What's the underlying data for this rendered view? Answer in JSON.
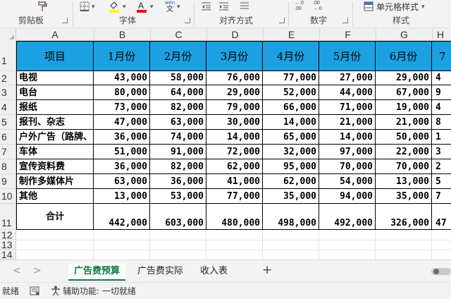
{
  "ribbon": {
    "clipboard": {
      "label": "剪贴板"
    },
    "font": {
      "label": "字体"
    },
    "alignment": {
      "label": "对齐方式"
    },
    "number": {
      "label": "数字"
    },
    "styles": {
      "label": "样式",
      "cell_styles_label": "单元格样式"
    },
    "wen_icon_text": "wén",
    "wen_icon_char": "文",
    "accent_colors": {
      "highlight": "#ffff00",
      "font_color": "#ff0000"
    }
  },
  "columns": [
    "A",
    "B",
    "C",
    "D",
    "E",
    "F",
    "G",
    "H"
  ],
  "rows": [
    "1",
    "2",
    "3",
    "4",
    "5",
    "6",
    "7",
    "8",
    "9",
    "10",
    "11",
    "12",
    "13",
    "14"
  ],
  "sheet": {
    "headers": [
      "项目",
      "1月份",
      "2月份",
      "3月份",
      "4月份",
      "5月份",
      "6月份",
      "7"
    ],
    "header_color": "#1ba1e2",
    "data": [
      {
        "item": "电视",
        "values": [
          "43,000",
          "58,000",
          "76,000",
          "77,000",
          "27,000",
          "29,000",
          "4"
        ]
      },
      {
        "item": "电台",
        "values": [
          "80,000",
          "64,000",
          "29,000",
          "52,000",
          "44,000",
          "67,000",
          "9"
        ]
      },
      {
        "item": "报纸",
        "values": [
          "73,000",
          "82,000",
          "79,000",
          "66,000",
          "71,000",
          "19,000",
          "4"
        ]
      },
      {
        "item": "报刊、杂志",
        "values": [
          "47,000",
          "63,000",
          "30,000",
          "14,000",
          "21,000",
          "21,000",
          "8"
        ]
      },
      {
        "item": "户外广告（路牌、",
        "values": [
          "36,000",
          "74,000",
          "14,000",
          "65,000",
          "14,000",
          "50,000",
          "1"
        ]
      },
      {
        "item": "车体",
        "values": [
          "51,000",
          "91,000",
          "72,000",
          "32,000",
          "97,000",
          "22,000",
          "3"
        ]
      },
      {
        "item": "宣传资料费",
        "values": [
          "36,000",
          "82,000",
          "62,000",
          "95,000",
          "70,000",
          "70,000",
          "2"
        ]
      },
      {
        "item": "制作多媒体片",
        "values": [
          "63,000",
          "36,000",
          "41,000",
          "62,000",
          "54,000",
          "13,000",
          "5"
        ]
      },
      {
        "item": "其他",
        "values": [
          "13,000",
          "53,000",
          "77,000",
          "35,000",
          "94,000",
          "35,000",
          "7"
        ]
      }
    ],
    "total": {
      "item": "合计",
      "values": [
        "442,000",
        "603,000",
        "480,000",
        "498,000",
        "492,000",
        "326,000",
        "47"
      ]
    }
  },
  "tabs": [
    {
      "label": "广告费预算",
      "active": true
    },
    {
      "label": "广告费实际",
      "active": false
    },
    {
      "label": "收入表",
      "active": false
    }
  ],
  "tab_nav": {
    "prev": "<",
    "next": ">",
    "add": "+"
  },
  "status": {
    "ready": "就绪",
    "accessibility": "辅助功能: 一切就绪"
  },
  "theme": {
    "accent": "#107c41"
  }
}
